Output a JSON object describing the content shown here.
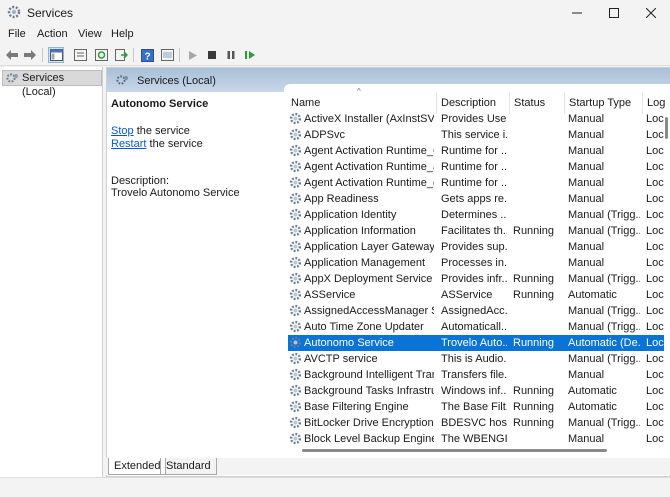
{
  "window": {
    "title": "Services",
    "icon": "gears-icon",
    "controls": [
      "minimize-icon",
      "maximize-icon",
      "close-icon"
    ]
  },
  "menu": {
    "items": [
      "File",
      "Action",
      "View",
      "Help"
    ]
  },
  "toolbar": {
    "buttons": [
      "back-arrow-icon",
      "forward-arrow-icon",
      "show-console-tree-icon",
      "properties-icon",
      "refresh-icon",
      "export-list-icon",
      "help-icon",
      "console-icon",
      "start-service-icon",
      "stop-service-icon",
      "pause-service-icon",
      "resume-service-icon"
    ]
  },
  "tree": {
    "root": "Services (Local)"
  },
  "content": {
    "header": "Services (Local)",
    "selected_service": "Autonomo Service",
    "stop_link": "Stop",
    "stop_suffix": " the service",
    "restart_link": "Restart",
    "restart_suffix": " the service",
    "description_label": "Description:",
    "description_text": "Trovelo Autonomo Service"
  },
  "table": {
    "columns": [
      "Name",
      "Description",
      "Status",
      "Startup Type",
      "Log"
    ],
    "rows": [
      {
        "name": "ActiveX Installer (AxInstSV)",
        "description": "Provides Use...",
        "status": "",
        "startup": "Manual",
        "log": "Loc"
      },
      {
        "name": "ADPSvc",
        "description": "This service i...",
        "status": "",
        "startup": "Manual",
        "log": "Loc"
      },
      {
        "name": "Agent Activation Runtime_6...",
        "description": "Runtime for ...",
        "status": "",
        "startup": "Manual",
        "log": "Loc"
      },
      {
        "name": "Agent Activation Runtime_a...",
        "description": "Runtime for ...",
        "status": "",
        "startup": "Manual",
        "log": "Loc"
      },
      {
        "name": "Agent Activation Runtime_cf...",
        "description": "Runtime for ...",
        "status": "",
        "startup": "Manual",
        "log": "Loc"
      },
      {
        "name": "App Readiness",
        "description": "Gets apps re...",
        "status": "",
        "startup": "Manual",
        "log": "Loc"
      },
      {
        "name": "Application Identity",
        "description": "Determines ...",
        "status": "",
        "startup": "Manual (Trigg...",
        "log": "Loc"
      },
      {
        "name": "Application Information",
        "description": "Facilitates th...",
        "status": "Running",
        "startup": "Manual (Trigg...",
        "log": "Loc"
      },
      {
        "name": "Application Layer Gateway S...",
        "description": "Provides sup...",
        "status": "",
        "startup": "Manual",
        "log": "Loc"
      },
      {
        "name": "Application Management",
        "description": "Processes in...",
        "status": "",
        "startup": "Manual",
        "log": "Loc"
      },
      {
        "name": "AppX Deployment Service (A...",
        "description": "Provides infr...",
        "status": "Running",
        "startup": "Manual (Trigg...",
        "log": "Loc"
      },
      {
        "name": "ASService",
        "description": "ASService",
        "status": "Running",
        "startup": "Automatic",
        "log": "Loc"
      },
      {
        "name": "AssignedAccessManager Ser...",
        "description": "AssignedAcc...",
        "status": "",
        "startup": "Manual (Trigg...",
        "log": "Loc"
      },
      {
        "name": "Auto Time Zone Updater",
        "description": "Automaticall...",
        "status": "",
        "startup": "Manual (Trigg...",
        "log": "Loc"
      },
      {
        "name": "Autonomo Service",
        "description": "Trovelo Auto...",
        "status": "Running",
        "startup": "Automatic (De...",
        "log": "Loc",
        "selected": true
      },
      {
        "name": "AVCTP service",
        "description": "This is Audio...",
        "status": "",
        "startup": "Manual (Trigg...",
        "log": "Loc"
      },
      {
        "name": "Background Intelligent Tran...",
        "description": "Transfers file...",
        "status": "",
        "startup": "Manual",
        "log": "Loc"
      },
      {
        "name": "Background Tasks Infrastruc...",
        "description": "Windows inf...",
        "status": "Running",
        "startup": "Automatic",
        "log": "Loc"
      },
      {
        "name": "Base Filtering Engine",
        "description": "The Base Filt...",
        "status": "Running",
        "startup": "Automatic",
        "log": "Loc"
      },
      {
        "name": "BitLocker Drive Encryption S...",
        "description": "BDESVC hos...",
        "status": "Running",
        "startup": "Manual (Trigg...",
        "log": "Loc"
      },
      {
        "name": "Block Level Backup Engine S...",
        "description": "The WBENGI...",
        "status": "",
        "startup": "Manual",
        "log": "Loc"
      }
    ]
  },
  "tabs": [
    "Extended",
    "Standard"
  ],
  "colors": {
    "selection": "#0a74d6",
    "link": "#0b57d0",
    "header_band": "#b9cde2"
  }
}
